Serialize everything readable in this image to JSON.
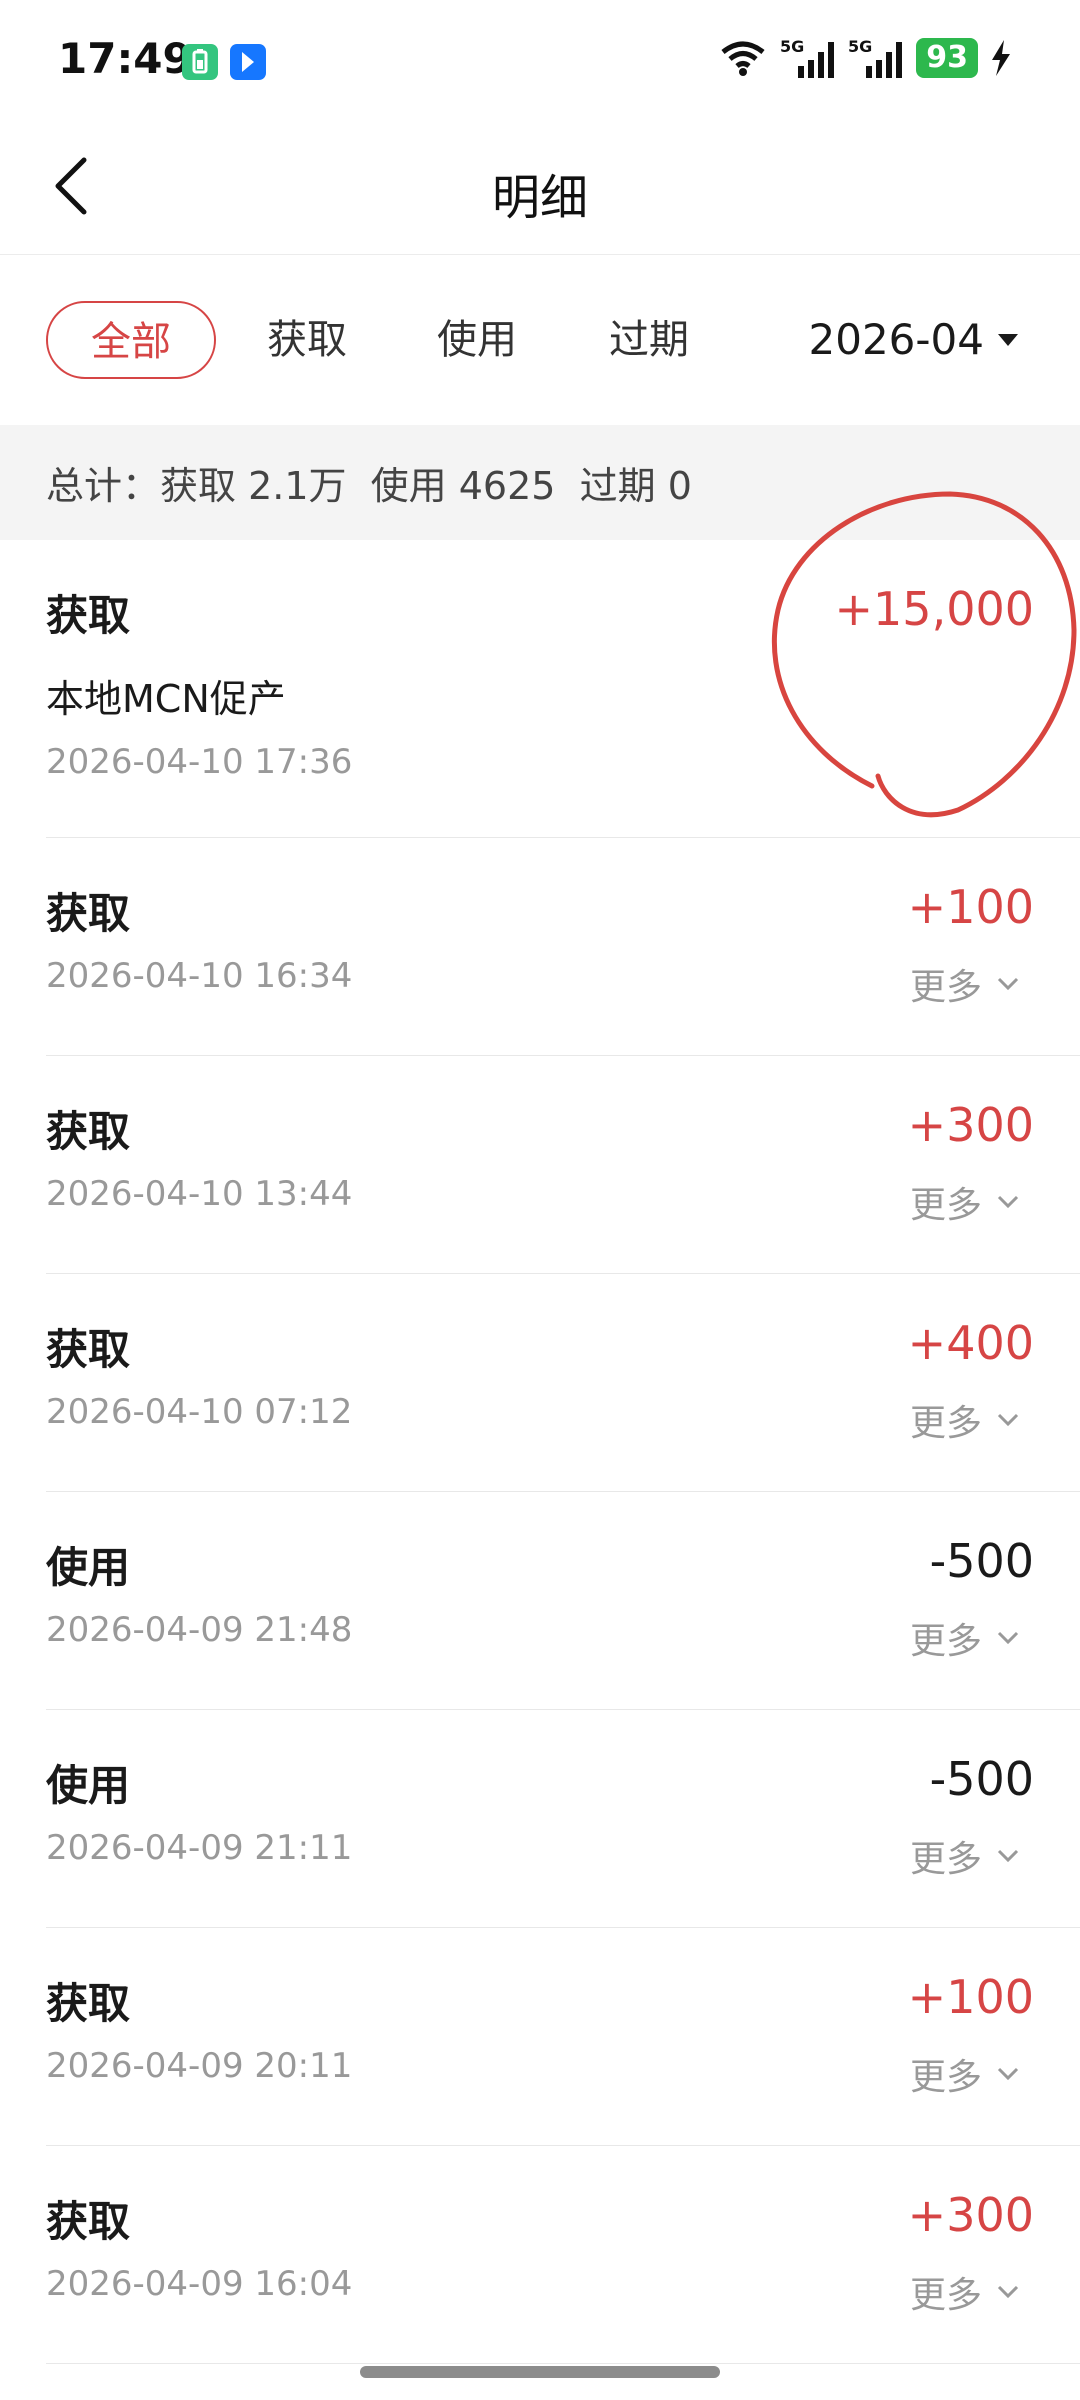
{
  "status_bar": {
    "time": "17:49",
    "battery": "93",
    "signal_a": "5G",
    "signal_b": "5G"
  },
  "header": {
    "title": "明细"
  },
  "tabs": [
    {
      "label": "全部",
      "active": true
    },
    {
      "label": "获取"
    },
    {
      "label": "使用"
    },
    {
      "label": "过期"
    }
  ],
  "month_filter": "2026-04",
  "summary": "总计：获取 2.1万  使用 4625  过期 0",
  "records": [
    {
      "type": "获取",
      "desc": "本地MCN促产",
      "time": "2026-04-10 17:36",
      "amount": "+15,000"
    },
    {
      "type": "获取",
      "time": "2026-04-10 16:34",
      "amount": "+100",
      "more": "更多"
    },
    {
      "type": "获取",
      "time": "2026-04-10 13:44",
      "amount": "+300",
      "more": "更多"
    },
    {
      "type": "获取",
      "time": "2026-04-10 07:12",
      "amount": "+400",
      "more": "更多"
    },
    {
      "type": "使用",
      "time": "2026-04-09 21:48",
      "amount": "-500",
      "more": "更多"
    },
    {
      "type": "使用",
      "time": "2026-04-09 21:11",
      "amount": "-500",
      "more": "更多"
    },
    {
      "type": "获取",
      "time": "2026-04-09 20:11",
      "amount": "+100",
      "more": "更多"
    },
    {
      "type": "获取",
      "time": "2026-04-09 16:04",
      "amount": "+300",
      "more": "更多"
    }
  ],
  "colors": {
    "accent": "#d64545",
    "summary_bg": "#f4f4f4",
    "battery": "#2db84d"
  },
  "icons": [
    "back-arrow-icon",
    "wifi-icon",
    "signal-icon",
    "charging-icon",
    "chevron-down-icon"
  ]
}
